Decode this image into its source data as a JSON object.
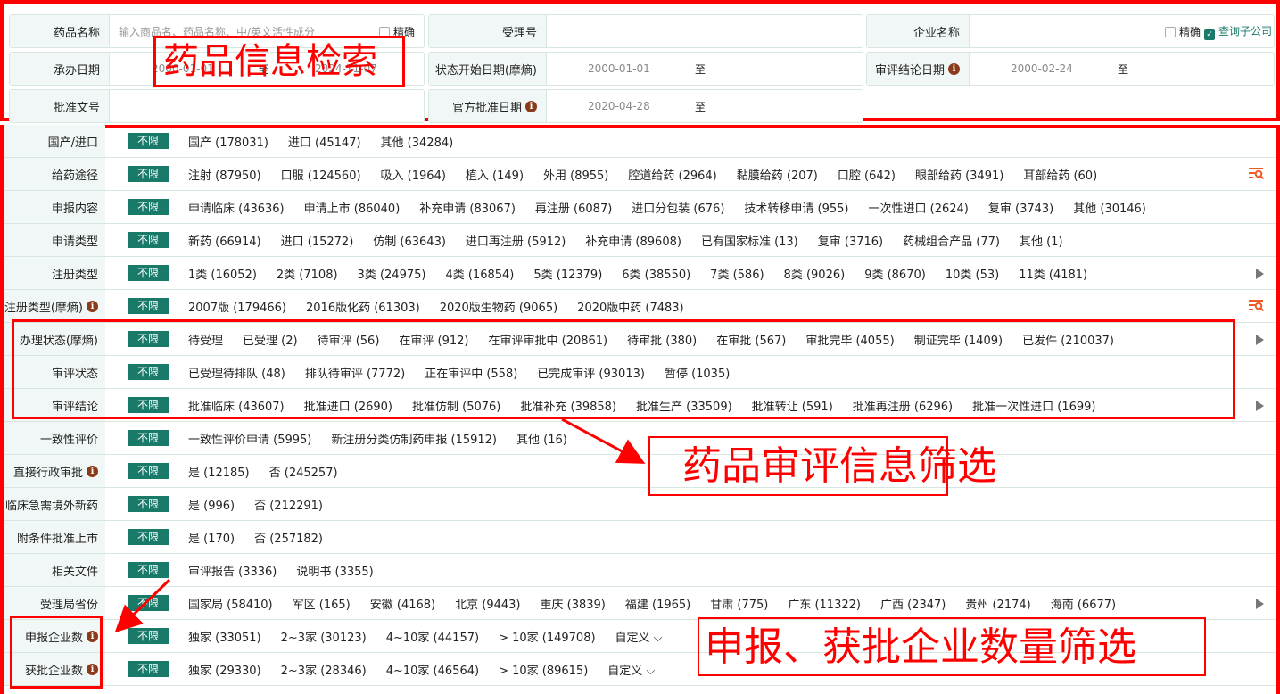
{
  "search": {
    "drug_name": {
      "label": "药品名称",
      "placeholder": "输入商品名、药品名称、中/英文活性成分",
      "exact": "精确"
    },
    "accept_no": {
      "label": "受理号"
    },
    "company": {
      "label": "企业名称",
      "exact": "精确",
      "subsidiary": "查询子公司"
    },
    "handle_date": {
      "label": "承办日期",
      "from": "2000-01-01",
      "to_label": "至",
      "to": "2024-11-07"
    },
    "status_date": {
      "label": "状态开始日期(摩熵)",
      "from": "2000-01-01",
      "to_label": "至"
    },
    "review_date": {
      "label": "审评结论日期",
      "from": "2000-02-24",
      "to_label": "至"
    },
    "approval_no": {
      "label": "批准文号"
    },
    "official_date": {
      "label": "官方批准日期",
      "from": "2020-04-28",
      "to_label": "至"
    }
  },
  "unlimited": "不限",
  "info_glyph": "i",
  "filters": [
    {
      "label": "国产/进口",
      "opts": [
        "国产 (178031)",
        "进口 (45147)",
        "其他 (34284)"
      ]
    },
    {
      "label": "给药途径",
      "opts": [
        "注射 (87950)",
        "口服 (124560)",
        "吸入 (1964)",
        "植入 (149)",
        "外用 (8955)",
        "腔道给药 (2964)",
        "黏膜给药 (207)",
        "口腔 (642)",
        "眼部给药 (3491)",
        "耳部给药 (60)"
      ],
      "end": "filter-search"
    },
    {
      "label": "申报内容",
      "opts": [
        "申请临床 (43636)",
        "申请上市 (86040)",
        "补充申请 (83067)",
        "再注册 (6087)",
        "进口分包装 (676)",
        "技术转移申请 (955)",
        "一次性进口 (2624)",
        "复审 (3743)",
        "其他 (30146)"
      ]
    },
    {
      "label": "申请类型",
      "opts": [
        "新药 (66914)",
        "进口 (15272)",
        "仿制 (63643)",
        "进口再注册 (5912)",
        "补充申请 (89608)",
        "已有国家标准 (13)",
        "复审 (3716)",
        "药械组合产品 (77)",
        "其他 (1)"
      ]
    },
    {
      "label": "注册类型",
      "opts": [
        "1类 (16052)",
        "2类 (7108)",
        "3类 (24975)",
        "4类 (16854)",
        "5类 (12379)",
        "6类 (38550)",
        "7类 (586)",
        "8类 (9026)",
        "9类 (8670)",
        "10类 (53)",
        "11类 (4181)"
      ],
      "end": "expand"
    },
    {
      "label": "注册类型(摩熵)",
      "info": true,
      "opts": [
        "2007版 (179466)",
        "2016版化药 (61303)",
        "2020版生物药 (9065)",
        "2020版中药 (7483)"
      ],
      "end": "filter-search"
    },
    {
      "label": "办理状态(摩熵)",
      "opts": [
        "待受理",
        "已受理 (2)",
        "待审评 (56)",
        "在审评 (912)",
        "在审评审批中 (20861)",
        "待审批 (380)",
        "在审批 (567)",
        "审批完毕 (4055)",
        "制证完毕 (1409)",
        "已发件 (210037)"
      ],
      "end": "expand"
    },
    {
      "label": "审评状态",
      "opts": [
        "已受理待排队 (48)",
        "排队待审评 (7772)",
        "正在审评中 (558)",
        "已完成审评 (93013)",
        "暂停 (1035)"
      ]
    },
    {
      "label": "审评结论",
      "opts": [
        "批准临床 (43607)",
        "批准进口 (2690)",
        "批准仿制 (5076)",
        "批准补充 (39858)",
        "批准生产 (33509)",
        "批准转让 (591)",
        "批准再注册 (6296)",
        "批准一次性进口 (1699)"
      ],
      "end": "expand"
    },
    {
      "label": "一致性评价",
      "opts": [
        "一致性评价申请 (5995)",
        "新注册分类仿制药申报 (15912)",
        "其他 (16)"
      ]
    },
    {
      "label": "直接行政审批",
      "info": true,
      "opts": [
        "是 (12185)",
        "否 (245257)"
      ]
    },
    {
      "label": "临床急需境外新药",
      "opts": [
        "是 (996)",
        "否 (212291)"
      ]
    },
    {
      "label": "附条件批准上市",
      "opts": [
        "是 (170)",
        "否 (257182)"
      ]
    },
    {
      "label": "相关文件",
      "opts": [
        "审评报告 (3336)",
        "说明书 (3355)"
      ]
    },
    {
      "label": "受理局省份",
      "opts": [
        "国家局 (58410)",
        "军区 (165)",
        "安徽 (4168)",
        "北京 (9443)",
        "重庆 (3839)",
        "福建 (1965)",
        "甘肃 (775)",
        "广东 (11322)",
        "广西 (2347)",
        "贵州 (2174)",
        "海南 (6677)"
      ],
      "end": "expand"
    },
    {
      "label": "申报企业数",
      "info": true,
      "opts": [
        "独家 (33051)",
        "2~3家 (30123)",
        "4~10家 (44157)",
        "> 10家 (149708)",
        "自定义 ⌵"
      ]
    },
    {
      "label": "获批企业数",
      "info": true,
      "opts": [
        "独家 (29330)",
        "2~3家 (28346)",
        "4~10家 (46564)",
        "> 10家 (89615)",
        "自定义 ⌵"
      ]
    }
  ],
  "annotations": {
    "search": "药品信息检索",
    "review": "药品审评信息筛选",
    "company": "申报、获批企业数量筛选"
  },
  "colors": {
    "accent": "#1a7a6a",
    "annotation": "#ff0000",
    "icon": "#f05a28"
  }
}
